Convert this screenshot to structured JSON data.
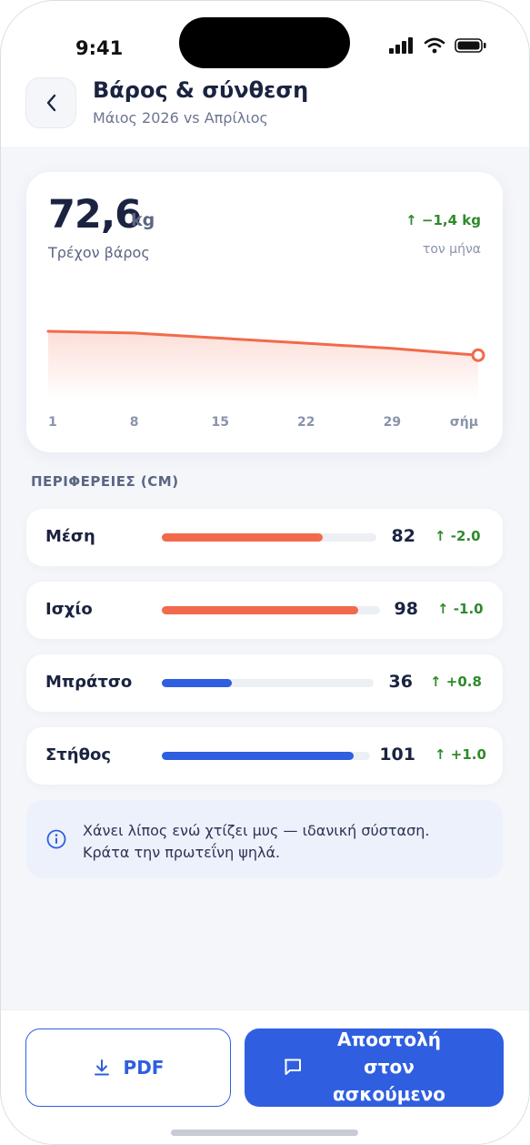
{
  "status_bar": {
    "time": "9:41"
  },
  "header": {
    "title": "Βάρος & σύνθεση",
    "subtitle": "Μάιος 2026 vs Απρίλιος"
  },
  "weight_card": {
    "value": "72,6",
    "unit": "kg",
    "label": "Τρέχον βάρος",
    "delta": "↑ −1,4 kg",
    "delta_sub": "τον μήνα",
    "x_ticks": [
      "1",
      "8",
      "15",
      "22",
      "29",
      "σήμ"
    ]
  },
  "chart_data": {
    "type": "area",
    "x": [
      "1",
      "8",
      "15",
      "22",
      "29",
      "σήμ"
    ],
    "series": [
      {
        "values": [
          74.0,
          73.9,
          73.6,
          73.3,
          73.0,
          72.6
        ]
      }
    ],
    "ylim": [
      70,
      78
    ],
    "colors": {
      "line": "#f26a4b",
      "fill": "#fde3dc"
    }
  },
  "measurements": {
    "heading": "ΠΕΡΙΦΕΡΕΙΕΣ (CM)",
    "rows": [
      {
        "name": "Μέση",
        "value": "82",
        "change": "↑ -2.0",
        "fill": 0.75,
        "color": "#f26a4b"
      },
      {
        "name": "Ισχίο",
        "value": "98",
        "change": "↑ -1.0",
        "fill": 0.9,
        "color": "#f26a4b"
      },
      {
        "name": "Μπράτσο",
        "value": "36",
        "change": "↑ +0.8",
        "fill": 0.33,
        "color": "#2f5fe0"
      },
      {
        "name": "Στήθος",
        "value": "101",
        "change": "↑ +1.0",
        "fill": 0.92,
        "color": "#2f5fe0"
      }
    ]
  },
  "info": {
    "line1": "Χάνει λίπος ενώ χτίζει μυς — ιδανική σύσταση.",
    "line2": "Κράτα την πρωτεΐνη ψηλά."
  },
  "actions": {
    "pdf_label": "PDF",
    "send_label_1": "Αποστολή",
    "send_label_2": "στον",
    "send_label_3": "ασκούμενο"
  },
  "colors": {
    "accent": "#2f5fe0",
    "coral": "#f26a4b",
    "positive": "#2f8a2b"
  }
}
